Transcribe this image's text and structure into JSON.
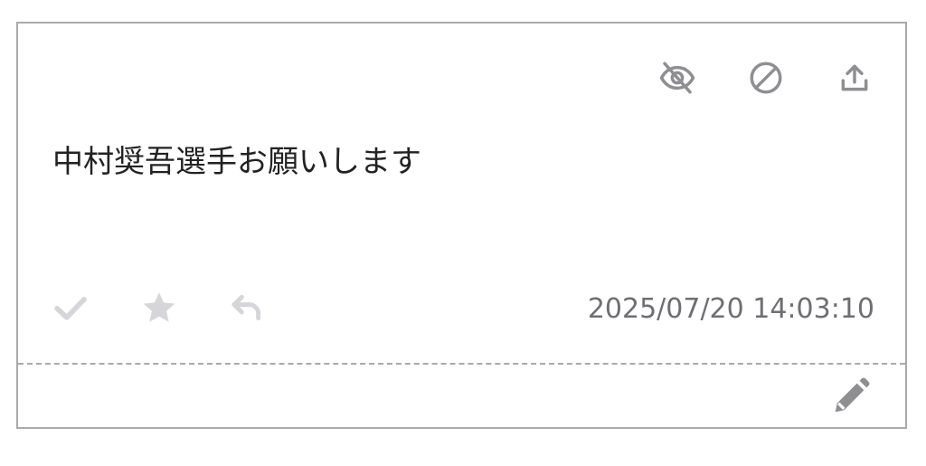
{
  "post": {
    "message": "中村奨吾選手お願いします",
    "timestamp": "2025/07/20 14:03:10"
  },
  "colors": {
    "border": "#a9a9ae",
    "icon_dark": "#8e8e93",
    "icon_light": "#d6d6da",
    "text": "#222222",
    "timestamp": "#6e6e74"
  },
  "icons": {
    "top": [
      "eye-slash-icon",
      "ban-icon",
      "upload-icon"
    ],
    "bottom": [
      "check-icon",
      "star-icon",
      "reply-icon"
    ],
    "footer": [
      "pencil-icon"
    ]
  }
}
